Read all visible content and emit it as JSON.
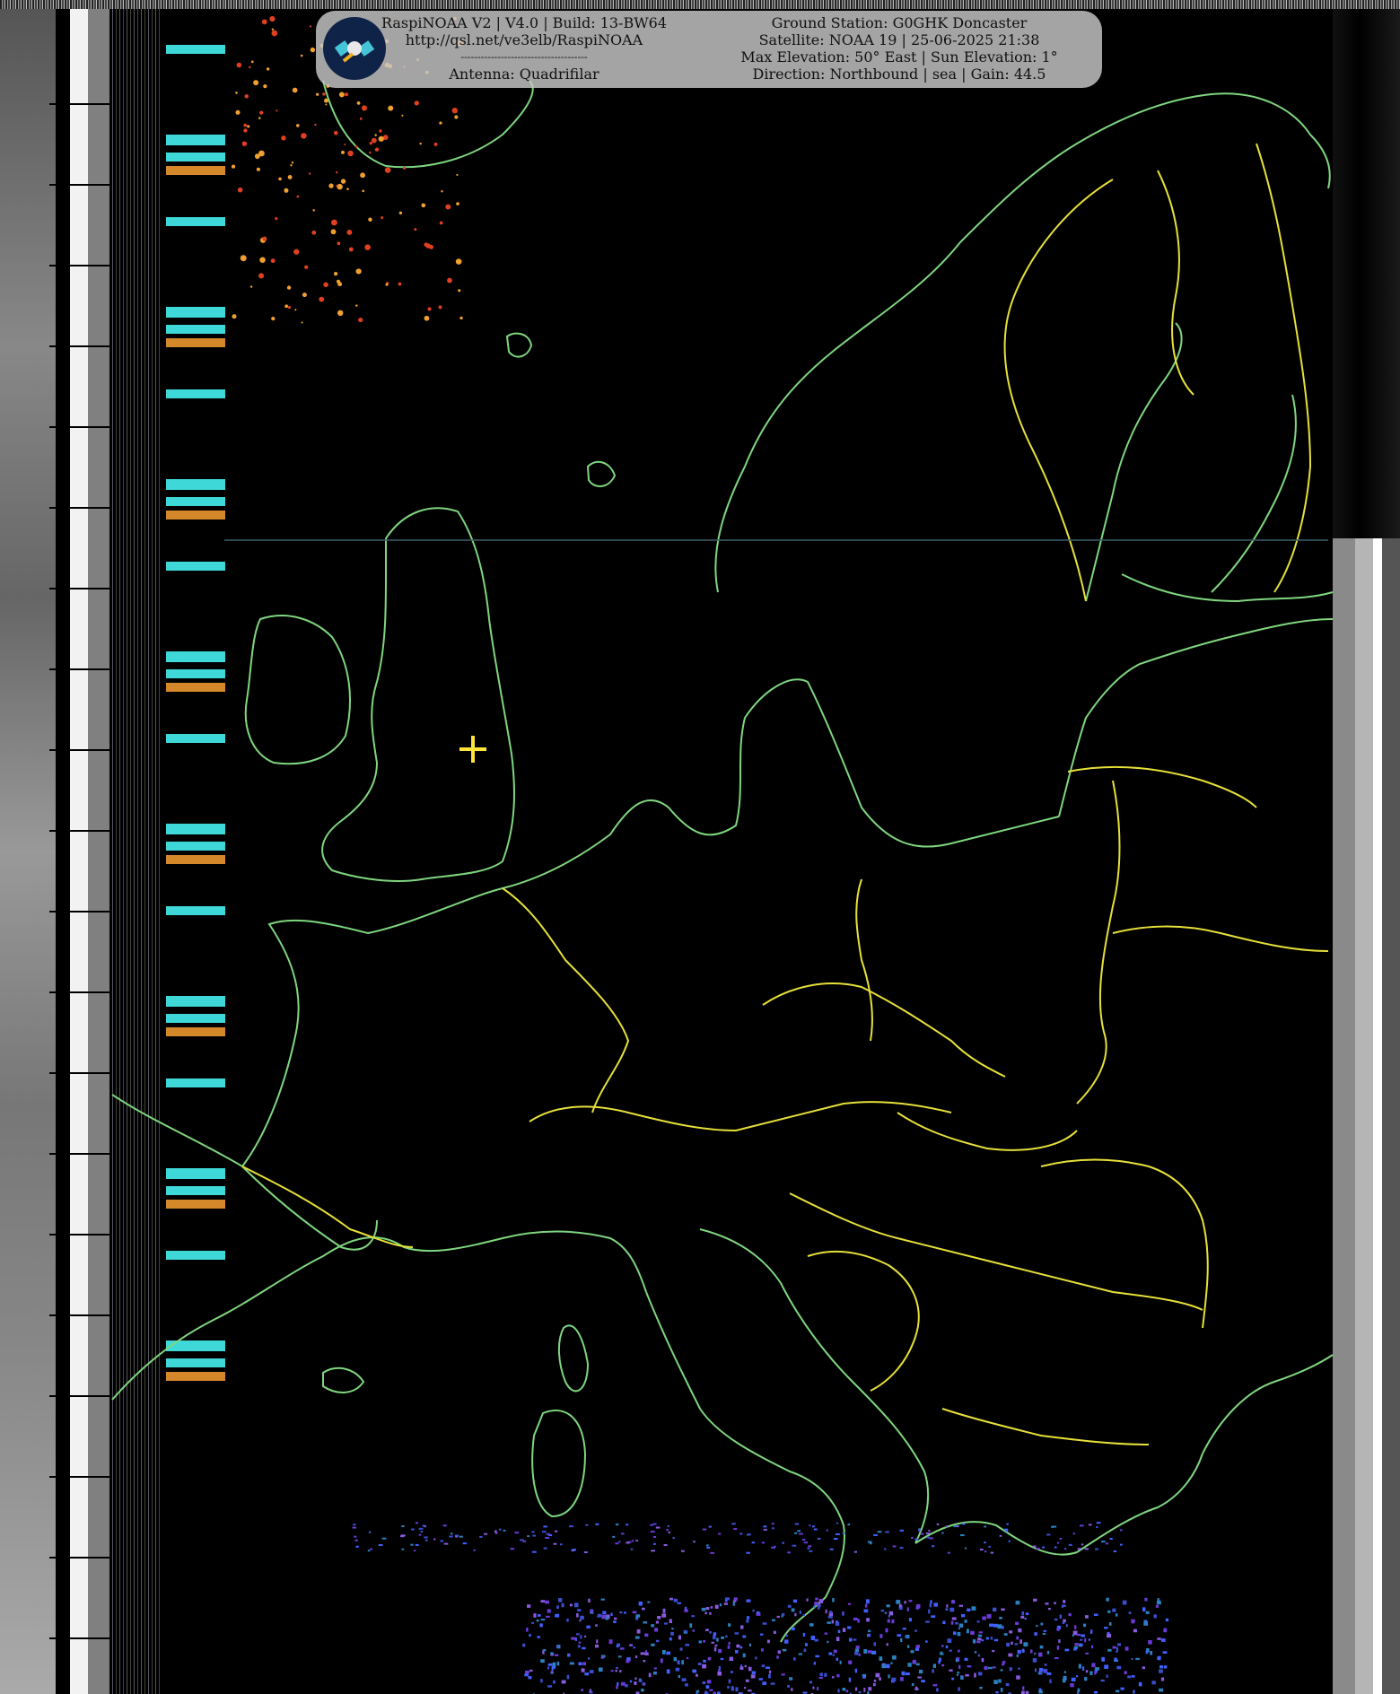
{
  "banner": {
    "left": {
      "line1": "RaspiNOAA V2 | V4.0 | Build: 13-BW64",
      "line2": "http://qsl.net/ve3elb/RaspiNOAA",
      "line3": "--------------------------------------",
      "line4": "Antenna: Quadrifilar"
    },
    "right": {
      "line1": "Ground Station: G0GHK Doncaster",
      "line2": "Satellite: NOAA 19 | 25-06-2025 21:38",
      "line3": "Max Elevation: 50° East | Sun Elevation: 1°",
      "line4": "Direction: Northbound | sea | Gain: 44.5"
    },
    "logo_icon": "satellite-icon"
  },
  "map": {
    "coast_color": "#7fd67f",
    "border_color": "#e6e03a",
    "marker_color": "#ffe23a",
    "marker_icon": "crosshair-icon"
  }
}
